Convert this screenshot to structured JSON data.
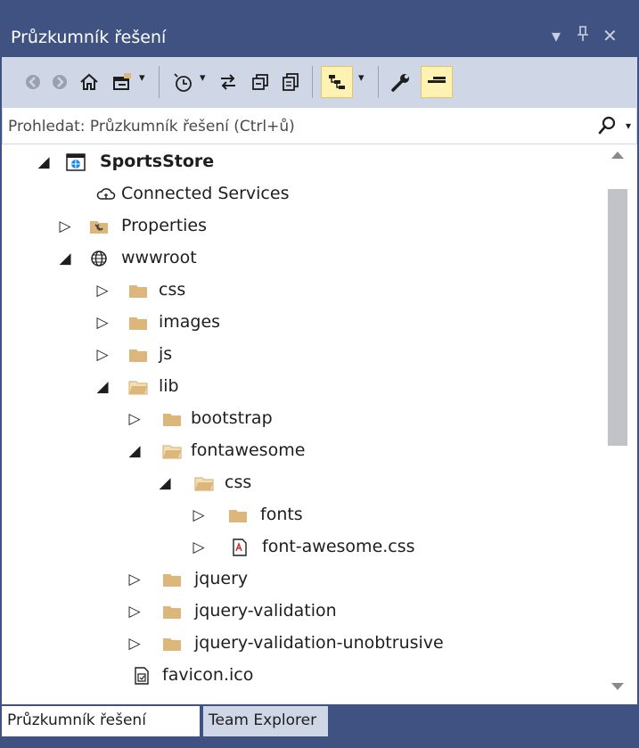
{
  "window": {
    "title": "Průzkumník řešení",
    "controls": {
      "dropdown": "▾",
      "pin": "⊥",
      "close": "✕"
    }
  },
  "toolbar": {
    "icons": [
      "back-icon",
      "forward-icon",
      "home-icon",
      "switch-views-icon",
      "pending-changes-filter-icon",
      "sync-icon",
      "collapse-all-icon",
      "show-all-files-icon",
      "preview-selected-icon",
      "properties-icon",
      "auto-hide-icon"
    ],
    "dropdown_glyph": "▾"
  },
  "search": {
    "placeholder": "Prohledat: Průzkumník řešení (Ctrl+ů)",
    "dropdown_glyph": "▾"
  },
  "tree": [
    {
      "label": "SportsStore",
      "expanded": true,
      "bold": true,
      "icon": "web-project-icon"
    },
    {
      "label": "Connected Services",
      "icon": "cloud-icon"
    },
    {
      "label": "Properties",
      "expanded": false,
      "icon": "properties-folder-icon"
    },
    {
      "label": "wwwroot",
      "expanded": true,
      "icon": "globe-icon"
    },
    {
      "label": "css",
      "expanded": false,
      "icon": "folder-icon"
    },
    {
      "label": "images",
      "expanded": false,
      "icon": "folder-icon"
    },
    {
      "label": "js",
      "expanded": false,
      "icon": "folder-icon"
    },
    {
      "label": "lib",
      "expanded": true,
      "icon": "folder-open-icon"
    },
    {
      "label": "bootstrap",
      "expanded": false,
      "icon": "folder-icon"
    },
    {
      "label": "fontawesome",
      "expanded": true,
      "icon": "folder-open-icon"
    },
    {
      "label": "css",
      "expanded": true,
      "icon": "folder-open-icon"
    },
    {
      "label": "fonts",
      "expanded": false,
      "icon": "folder-icon"
    },
    {
      "label": "font-awesome.css",
      "expanded": false,
      "icon": "css-file-icon"
    },
    {
      "label": "jquery",
      "expanded": false,
      "icon": "folder-icon"
    },
    {
      "label": "jquery-validation",
      "expanded": false,
      "icon": "folder-icon"
    },
    {
      "label": "jquery-validation-unobtrusive",
      "expanded": false,
      "icon": "folder-icon"
    },
    {
      "label": "favicon.ico",
      "icon": "ico-file-icon"
    }
  ],
  "arrows": {
    "expanded": "◢",
    "collapsed": "▷"
  },
  "tabs": [
    {
      "label": "Průzkumník řešení",
      "active": true
    },
    {
      "label": "Team Explorer",
      "active": false
    }
  ],
  "colors": {
    "title_bar": "#3f5282",
    "toolbar": "#cfd6e5",
    "folder": "#dcb67a",
    "active_tool": "#fff2b3"
  }
}
